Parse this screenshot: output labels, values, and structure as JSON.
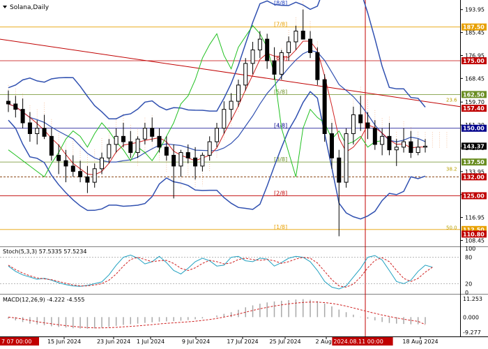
{
  "chart_data": {
    "type": "candlestick",
    "title": "Solana,Daily",
    "x_ticks": [
      {
        "label": "7 07 00:00",
        "highlight": true
      },
      {
        "label": "15 Jun 2024"
      },
      {
        "label": "23 Jun 2024"
      },
      {
        "label": "1 Jul 2024"
      },
      {
        "label": "9 Jul 2024"
      },
      {
        "label": "17 Jul 2024"
      },
      {
        "label": "25 Jul 2024"
      },
      {
        "label": "2 Aug 2"
      },
      {
        "label": "2024.08.11 00:00",
        "highlight": true
      },
      {
        "label": "18 Aug 2024"
      }
    ],
    "y_ticks": [
      193.95,
      185.45,
      176.95,
      168.45,
      159.7,
      151.2,
      142.7,
      133.95,
      125.45,
      116.95,
      108.45
    ],
    "ylim": [
      106.5,
      197.5
    ],
    "price_labels": [
      {
        "value": 187.5,
        "label": "187.50",
        "color": "#e8a000"
      },
      {
        "value": 175.0,
        "label": "175.00",
        "color": "#c00000"
      },
      {
        "value": 162.5,
        "label": "162.50",
        "color": "#6b8e23"
      },
      {
        "value": 157.4,
        "label": "157.40",
        "color": "#c00000"
      },
      {
        "value": 150.0,
        "label": "150.00",
        "color": "#00008b"
      },
      {
        "value": 143.37,
        "label": "143.37",
        "color": "#000000"
      },
      {
        "value": 137.5,
        "label": "137.50",
        "color": "#6b8e23"
      },
      {
        "value": 132.0,
        "label": "132.00",
        "color": "#c00000"
      },
      {
        "value": 125.0,
        "label": "125.00",
        "color": "#c00000"
      },
      {
        "value": 112.5,
        "label": "112.50",
        "color": "#e8a000"
      },
      {
        "value": 110.8,
        "label": "110.80",
        "color": "#c00000"
      }
    ],
    "levels": [
      {
        "value": 200.0,
        "label": "[8/8]",
        "color": "#2040c0"
      },
      {
        "value": 187.5,
        "label": "[7/8]",
        "color": "#e8a000"
      },
      {
        "value": 175.0,
        "label": "[6/8]",
        "color": "#c00000"
      },
      {
        "value": 162.5,
        "label": "[5/8]",
        "color": "#6b8e23"
      },
      {
        "value": 150.0,
        "label": "[4/8]",
        "color": "#00008b"
      },
      {
        "value": 137.5,
        "label": "[3/8]",
        "color": "#6b8e23"
      },
      {
        "value": 125.0,
        "label": "[2/8]",
        "color": "#c00000"
      },
      {
        "value": 112.5,
        "label": "[1/8]",
        "color": "#e8a000"
      }
    ],
    "fib_labels": [
      {
        "value": 159.6,
        "label": "23.6"
      },
      {
        "value": 134.0,
        "label": "38.2"
      },
      {
        "value": 112.3,
        "label": "50.0"
      }
    ],
    "candles": [
      [
        160,
        164,
        156,
        159
      ],
      [
        159,
        162,
        154,
        157
      ],
      [
        157,
        161,
        150,
        152
      ],
      [
        152,
        156,
        145,
        148
      ],
      [
        148,
        153,
        144,
        150
      ],
      [
        150,
        155,
        146,
        147
      ],
      [
        147,
        150,
        138,
        140
      ],
      [
        140,
        144,
        133,
        138
      ],
      [
        138,
        142,
        130,
        136
      ],
      [
        136,
        140,
        132,
        134
      ],
      [
        134,
        138,
        130,
        132
      ],
      [
        132,
        136,
        126,
        130
      ],
      [
        130,
        137,
        128,
        135
      ],
      [
        135,
        141,
        133,
        139
      ],
      [
        139,
        146,
        137,
        144
      ],
      [
        144,
        150,
        141,
        147
      ],
      [
        147,
        152,
        143,
        145
      ],
      [
        145,
        149,
        139,
        141
      ],
      [
        141,
        147,
        139,
        146
      ],
      [
        146,
        152,
        144,
        150
      ],
      [
        150,
        154,
        145,
        147
      ],
      [
        147,
        150,
        141,
        143
      ],
      [
        143,
        147,
        138,
        140
      ],
      [
        140,
        144,
        124,
        136
      ],
      [
        136,
        142,
        132,
        141
      ],
      [
        141,
        144,
        137,
        139
      ],
      [
        139,
        143,
        131,
        136
      ],
      [
        136,
        141,
        134,
        140
      ],
      [
        140,
        147,
        138,
        145
      ],
      [
        145,
        152,
        143,
        150
      ],
      [
        150,
        160,
        148,
        157
      ],
      [
        157,
        163,
        153,
        160
      ],
      [
        160,
        168,
        158,
        166
      ],
      [
        166,
        176,
        164,
        174
      ],
      [
        174,
        182,
        170,
        179
      ],
      [
        179,
        186,
        176,
        183
      ],
      [
        183,
        185,
        172,
        175
      ],
      [
        175,
        180,
        168,
        170
      ],
      [
        170,
        179,
        168,
        178
      ],
      [
        178,
        184,
        175,
        182
      ],
      [
        182,
        188,
        179,
        186
      ],
      [
        186,
        194,
        184,
        183
      ],
      [
        183,
        186,
        176,
        178
      ],
      [
        178,
        180,
        166,
        168
      ],
      [
        168,
        170,
        145,
        148
      ],
      [
        148,
        152,
        135,
        139
      ],
      [
        139,
        142,
        110,
        130
      ],
      [
        130,
        150,
        128,
        148
      ],
      [
        148,
        158,
        144,
        155
      ],
      [
        155,
        162,
        149,
        152
      ],
      [
        152,
        156,
        146,
        150
      ],
      [
        150,
        153,
        142,
        144
      ],
      [
        144,
        150,
        140,
        147
      ],
      [
        147,
        152,
        140,
        142
      ],
      [
        142,
        146,
        136,
        143
      ],
      [
        143,
        150,
        141,
        145
      ],
      [
        145,
        149,
        139,
        141
      ],
      [
        141,
        146,
        140,
        143
      ],
      [
        143,
        146,
        141,
        143.37
      ]
    ],
    "stoch": {
      "label": "Stoch(5,3,3) 57.5335 57.5234",
      "levels": [
        80,
        20
      ],
      "axis": [
        100,
        80,
        20,
        0
      ],
      "k": [
        60,
        48,
        40,
        35,
        30,
        32,
        28,
        22,
        18,
        15,
        14,
        16,
        20,
        24,
        40,
        62,
        80,
        85,
        78,
        65,
        70,
        82,
        68,
        50,
        42,
        55,
        70,
        78,
        72,
        60,
        62,
        80,
        82,
        72,
        70,
        78,
        76,
        60,
        68,
        78,
        82,
        80,
        70,
        50,
        25,
        12,
        8,
        15,
        35,
        55,
        80,
        84,
        74,
        50,
        25,
        20,
        28,
        48,
        62,
        57.53
      ],
      "d": [
        62,
        52,
        44,
        38,
        33,
        31,
        29,
        25,
        21,
        17,
        15,
        15,
        17,
        20,
        28,
        42,
        60,
        75,
        80,
        75,
        70,
        72,
        73,
        66,
        55,
        50,
        56,
        66,
        73,
        70,
        65,
        67,
        75,
        78,
        75,
        73,
        75,
        72,
        66,
        70,
        76,
        80,
        78,
        67,
        48,
        29,
        15,
        12,
        19,
        35,
        56,
        73,
        79,
        70,
        50,
        32,
        25,
        32,
        46,
        57.52
      ]
    },
    "macd": {
      "label": "MACD(12,26,9) -4.222 -4.555",
      "axis": [
        11.253,
        0.0,
        -9.277
      ],
      "hist": [
        -1,
        -2,
        -3,
        -4,
        -4.5,
        -5,
        -5.6,
        -6,
        -6.4,
        -6.8,
        -7,
        -7.1,
        -6.9,
        -6.5,
        -6,
        -5.4,
        -4.8,
        -4.4,
        -4,
        -3.6,
        -3.2,
        -2.8,
        -2.6,
        -2.5,
        -2.2,
        -1.8,
        -1.3,
        -0.8,
        0,
        1,
        2,
        3,
        4.5,
        6,
        7.2,
        8.2,
        9,
        9.6,
        10,
        10.4,
        10.8,
        11,
        10.6,
        9.8,
        8.4,
        6.6,
        4.6,
        3,
        1.5,
        0.2,
        -1,
        -2,
        -3,
        -3.6,
        -4,
        -4.2,
        -4.4,
        -4.4,
        -4.222
      ],
      "signal": [
        0,
        -0.5,
        -1.2,
        -2,
        -2.8,
        -3.5,
        -4.1,
        -4.7,
        -5.2,
        -5.7,
        -6.1,
        -6.4,
        -6.6,
        -6.6,
        -6.5,
        -6.3,
        -6,
        -5.7,
        -5.4,
        -5,
        -4.6,
        -4.2,
        -3.8,
        -3.5,
        -3.2,
        -2.9,
        -2.5,
        -2,
        -1.5,
        -0.8,
        0,
        0.9,
        1.9,
        3,
        4.1,
        5.1,
        6,
        6.8,
        7.5,
        8.1,
        8.6,
        9,
        9.2,
        9.2,
        8.9,
        8.4,
        7.6,
        6.7,
        5.6,
        4.5,
        3.4,
        2.3,
        1.3,
        0.4,
        -0.5,
        -1.3,
        -2,
        -2.6,
        -4.555
      ]
    }
  }
}
